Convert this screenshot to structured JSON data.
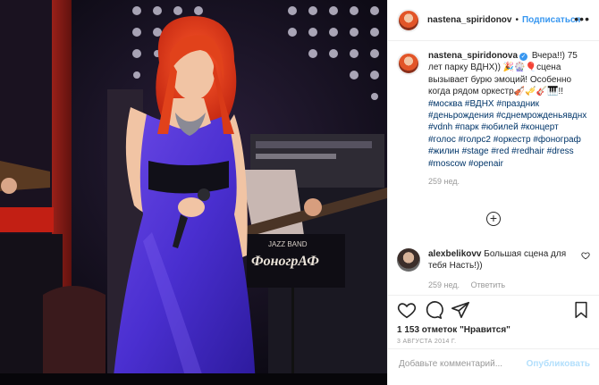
{
  "photo": {
    "band_logo_top": "JAZZ BAND",
    "band_logo": "ФоногрАФ"
  },
  "post": {
    "username": "nastena_spiridonov",
    "separator": "•",
    "follow_label": "Подписаться",
    "more_label": "•••"
  },
  "caption": {
    "username": "nastena_spiridonova",
    "text_before": "Вчера!!) 75 лет парку ВДНХ)) 🎉🎡🎈сцена вызывает бурю эмоций! Особенно когда рядом оркестр🎻🎺🎸🎹!! ",
    "hashtags": [
      "#москва",
      "#ВДНХ",
      "#праздник",
      "#деньрождения",
      "#сднемрожденьявднх",
      "#vdnh",
      "#парк",
      "#юбилей",
      "#концерт",
      "#голос",
      "#голрс2",
      "#оркестр",
      "#фонограф",
      "#жилин",
      "#stage",
      "#red",
      "#redhair",
      "#dress",
      "#moscow",
      "#openair"
    ],
    "time": "259 нед."
  },
  "comments": [
    {
      "username": "alexbelikovv",
      "text": "Большая сцена для тебя Насть!))",
      "time": "259 нед.",
      "reply_label": "Ответить"
    }
  ],
  "actions": {
    "likes_count": "1 153",
    "likes_text_middle": " отметок ",
    "likes_quote": "\"Нравится\"",
    "date": "3 АВГУСТА 2014 Г."
  },
  "add_comment": {
    "placeholder": "Добавьте комментарий...",
    "publish_label": "Опубликовать"
  },
  "colors": {
    "link": "#3897f0",
    "hashtag": "#003569",
    "publish_disabled": "#b2dffc",
    "muted": "#999999"
  },
  "icons": [
    "heart-icon",
    "comment-icon",
    "share-icon",
    "bookmark-icon",
    "plus-circle-icon",
    "more-icon",
    "verified-icon"
  ]
}
